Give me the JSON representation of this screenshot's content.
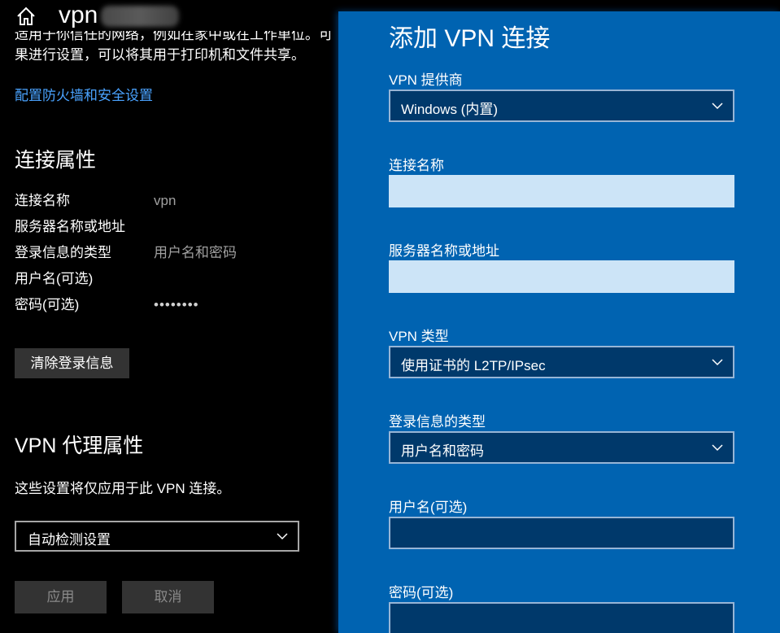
{
  "window": {
    "title": "vpn"
  },
  "network": {
    "description_line1": "适用于你信任的网络，例如在家中或在工作单位。可",
    "description_line2": "果进行设置，可以将其用于打印机和文件共享。",
    "firewall_link": "配置防火墙和安全设置"
  },
  "connection_properties": {
    "heading": "连接属性",
    "rows": [
      {
        "label": "连接名称",
        "value": "vpn"
      },
      {
        "label": "服务器名称或地址",
        "value": ""
      },
      {
        "label": "登录信息的类型",
        "value": "用户名和密码"
      },
      {
        "label": "用户名(可选)",
        "value": ""
      },
      {
        "label": "密码(可选)",
        "value": "••••••••"
      }
    ],
    "clear_button": "清除登录信息"
  },
  "proxy": {
    "heading": "VPN 代理属性",
    "note": "这些设置将仅应用于此 VPN 连接。",
    "select_value": "自动检测设置",
    "apply_button": "应用",
    "cancel_button": "取消"
  },
  "dialog": {
    "title": "添加 VPN 连接",
    "provider_label": "VPN 提供商",
    "provider_value": "Windows (内置)",
    "conn_name_label": "连接名称",
    "conn_name_value": "",
    "server_label": "服务器名称或地址",
    "server_value": "",
    "vpn_type_label": "VPN 类型",
    "vpn_type_value": "使用证书的 L2TP/IPsec",
    "signin_label": "登录信息的类型",
    "signin_value": "用户名和密码",
    "username_label": "用户名(可选)",
    "username_value": "",
    "password_label": "密码(可选)",
    "password_value": ""
  },
  "colors": {
    "dialog_bg": "#0063b1",
    "field_dark": "#00396b",
    "field_light": "#cce4f7",
    "link": "#4aa3ff"
  }
}
